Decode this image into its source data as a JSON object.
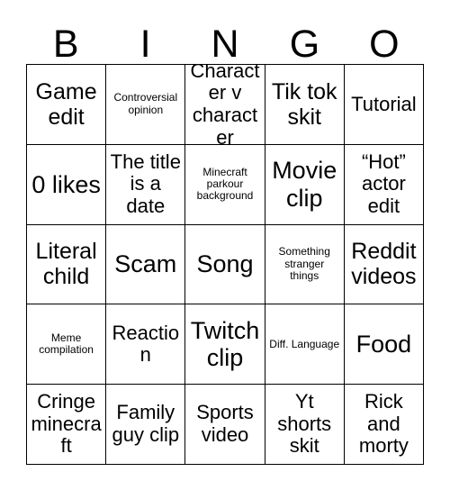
{
  "card": {
    "headers": [
      "B",
      "I",
      "N",
      "G",
      "O"
    ],
    "colors": {
      "background": "#ffffff",
      "border": "#000000",
      "text": "#000000"
    },
    "rows": [
      [
        {
          "text": "Game edit",
          "size": "lg"
        },
        {
          "text": "Controversial opinion",
          "size": "sm"
        },
        {
          "text": "Character v character",
          "size": "md"
        },
        {
          "text": "Tik tok skit",
          "size": "lg"
        },
        {
          "text": "Tutorial",
          "size": "md"
        }
      ],
      [
        {
          "text": "0 likes",
          "size": "xl"
        },
        {
          "text": "The title is a date",
          "size": "md"
        },
        {
          "text": "Minecraft parkour background",
          "size": "sm"
        },
        {
          "text": "Movie clip",
          "size": "xl"
        },
        {
          "text": "“Hot” actor edit",
          "size": "md"
        }
      ],
      [
        {
          "text": "Literal child",
          "size": "lg"
        },
        {
          "text": "Scam",
          "size": "xl"
        },
        {
          "text": "Song",
          "size": "xl"
        },
        {
          "text": "Something stranger things",
          "size": "sm"
        },
        {
          "text": "Reddit videos",
          "size": "lg"
        }
      ],
      [
        {
          "text": "Meme compilation",
          "size": "sm"
        },
        {
          "text": "Reaction",
          "size": "md"
        },
        {
          "text": "Twitch clip",
          "size": "xl"
        },
        {
          "text": "Diff. Language",
          "size": "sm"
        },
        {
          "text": "Food",
          "size": "xl"
        }
      ],
      [
        {
          "text": "Cringe minecraft",
          "size": "md"
        },
        {
          "text": "Family guy clip",
          "size": "md"
        },
        {
          "text": "Sports video",
          "size": "md"
        },
        {
          "text": "Yt shorts skit",
          "size": "md"
        },
        {
          "text": "Rick and morty",
          "size": "md"
        }
      ]
    ]
  }
}
